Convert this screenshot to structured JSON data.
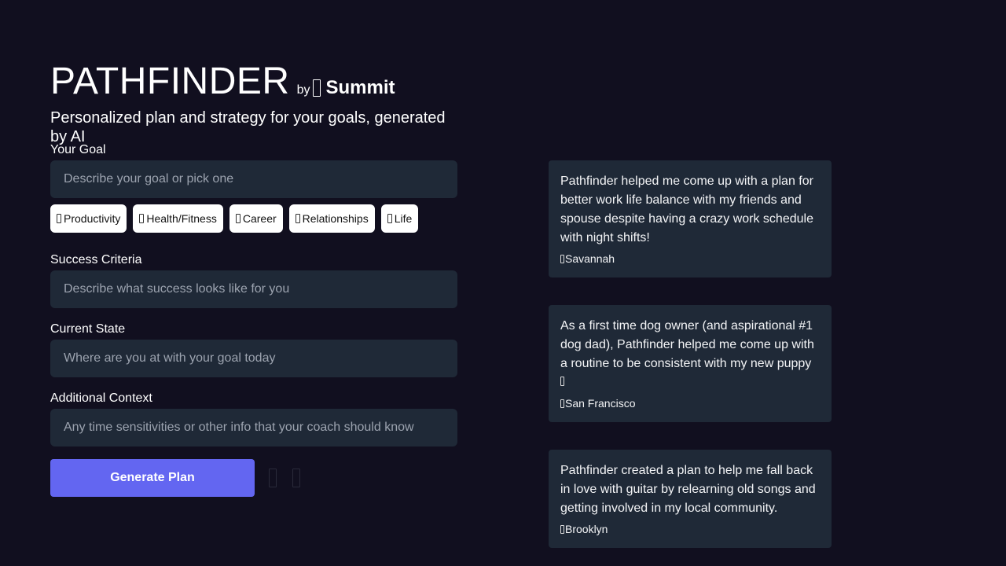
{
  "header": {
    "title": "PATHFINDER",
    "by": "by",
    "brand": "Summit",
    "subtitle": "Personalized plan and strategy for your goals, generated by AI"
  },
  "form": {
    "goal": {
      "label": "Your Goal",
      "placeholder": "Describe your goal or pick one",
      "value": ""
    },
    "chips": [
      {
        "label": "Productivity",
        "icon": "productivity-icon"
      },
      {
        "label": "Health/Fitness",
        "icon": "fitness-icon"
      },
      {
        "label": "Career",
        "icon": "career-icon"
      },
      {
        "label": "Relationships",
        "icon": "relationships-icon"
      },
      {
        "label": "Life",
        "icon": "life-icon"
      }
    ],
    "success": {
      "label": "Success Criteria",
      "placeholder": "Describe what success looks like for you",
      "value": ""
    },
    "current": {
      "label": "Current State",
      "placeholder": "Where are you at with your goal today",
      "value": ""
    },
    "context": {
      "label": "Additional Context",
      "placeholder": "Any time sensitivities or other info that your coach should know",
      "value": ""
    },
    "generate_label": "Generate Plan"
  },
  "testimonials": [
    {
      "quote": "Pathfinder helped me come up with a plan for better work life balance with my friends and spouse despite having a crazy work schedule with night shifts!",
      "author": "Savannah"
    },
    {
      "quote": "As a first time dog owner (and aspirational #1 dog dad), Pathfinder helped me come up with a routine to be consistent with my new puppy",
      "author": "San Francisco"
    },
    {
      "quote": "Pathfinder created a plan to help me fall back in love with guitar by relearning old songs and getting involved in my local community.",
      "author": "Brooklyn"
    }
  ],
  "colors": {
    "background": "#110f1f",
    "field": "#1f2937",
    "accent": "#6366f1",
    "card": "#1f2937"
  }
}
